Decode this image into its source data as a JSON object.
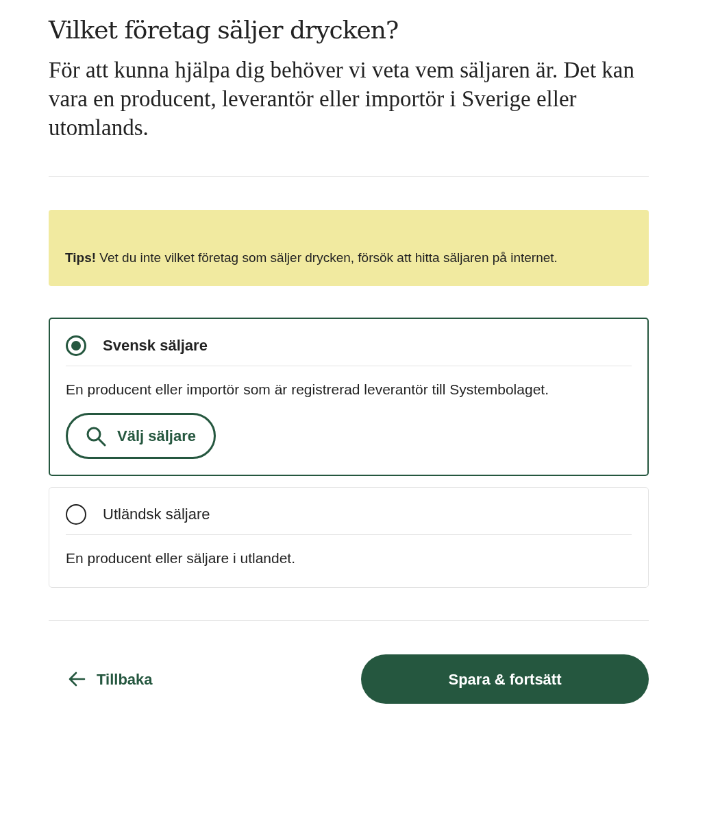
{
  "title": "Vilket företag säljer drycken?",
  "intro": "För att kunna hjälpa dig behöver vi veta vem säljaren är. Det kan vara en producent, leverantör eller importör i Sverige eller utomlands.",
  "tip": "**Tips!** Vet du inte vilket företag som säljer drycken, försök att hitta säljaren på internet.",
  "options": [
    {
      "label": "Svensk säljare",
      "selected": true,
      "description": "En producent eller importör som är registrerad leverantör till Systembolaget.",
      "button": "Välj säljare"
    },
    {
      "label": "Utländsk säljare",
      "selected": false,
      "description": "En producent eller säljare i utlandet."
    }
  ],
  "back": "Tillbaka",
  "submit": "Spara & fortsätt"
}
